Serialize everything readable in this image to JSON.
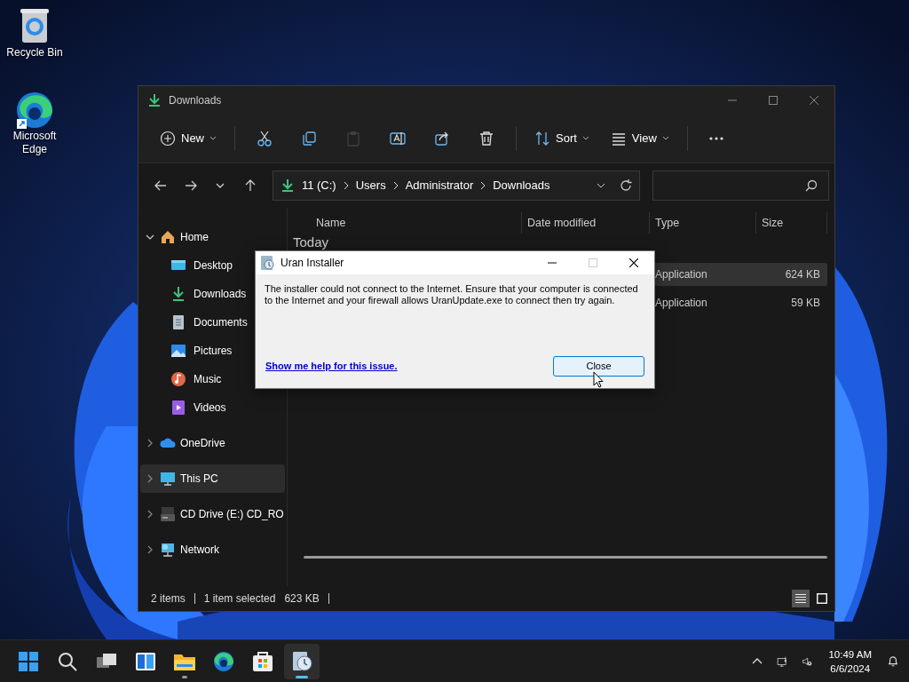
{
  "desktop_icons": [
    {
      "label": "Recycle Bin"
    },
    {
      "label": "Microsoft Edge"
    }
  ],
  "window": {
    "title": "Downloads"
  },
  "toolbar": [
    {
      "kind": "labeled",
      "label": "New",
      "disabled": false
    },
    {
      "kind": "icon",
      "disabled": false
    },
    {
      "kind": "icon",
      "disabled": false
    },
    {
      "kind": "icon",
      "disabled": true
    },
    {
      "kind": "icon",
      "disabled": false
    },
    {
      "kind": "icon",
      "disabled": false
    },
    {
      "kind": "icon",
      "disabled": false
    },
    {
      "kind": "labeled",
      "label": "Sort",
      "disabled": false
    },
    {
      "kind": "labeled",
      "label": "View",
      "disabled": false
    },
    {
      "kind": "icon",
      "disabled": false
    }
  ],
  "address": {
    "breadcrumb": [
      "11 (C:)",
      "Users",
      "Administrator",
      "Downloads"
    ]
  },
  "sidebar": {
    "items": [
      {
        "label": "Home",
        "expanded": true,
        "selected": false,
        "children": [
          {
            "label": "Desktop",
            "selected": false
          },
          {
            "label": "Downloads",
            "selected": false
          },
          {
            "label": "Documents",
            "selected": false
          },
          {
            "label": "Pictures",
            "selected": false
          },
          {
            "label": "Music",
            "selected": false
          },
          {
            "label": "Videos",
            "selected": false
          }
        ]
      },
      {
        "label": "OneDrive",
        "expanded": false,
        "selected": false
      },
      {
        "label": "This PC",
        "expanded": false,
        "selected": true
      },
      {
        "label": "CD Drive (E:) CD_RO",
        "expanded": false,
        "selected": false
      },
      {
        "label": "Network",
        "expanded": false,
        "selected": false
      }
    ]
  },
  "table": {
    "columns": [
      "Name",
      "Date modified",
      "Type",
      "Size"
    ],
    "group": "Today",
    "rows": [
      {
        "type": "Application",
        "size": "624 KB",
        "selected": true
      },
      {
        "type": "Application",
        "size": "59 KB",
        "selected": false
      }
    ]
  },
  "status_bar": {
    "items": "2 items",
    "selection": "1 item selected",
    "size": "623 KB",
    "views": [
      {
        "selected": true
      },
      {
        "selected": false
      }
    ]
  },
  "dialog": {
    "title": "Uran Installer",
    "message": "The installer could not connect to the Internet. Ensure that your computer is connected to the Internet and your firewall allows UranUpdate.exe to connect then try again.",
    "link": "Show me help for this issue.",
    "button": "Close",
    "maximize_disabled": true
  },
  "taskbar": {
    "apps": [
      {
        "running": false,
        "active": false
      },
      {
        "running": false,
        "active": false
      },
      {
        "running": false,
        "active": false
      },
      {
        "running": false,
        "active": false
      },
      {
        "running": true,
        "active": false
      },
      {
        "running": false,
        "active": false
      },
      {
        "running": false,
        "active": false
      },
      {
        "running": true,
        "active": true
      }
    ],
    "time": "10:49 AM",
    "date": "6/6/2024"
  }
}
